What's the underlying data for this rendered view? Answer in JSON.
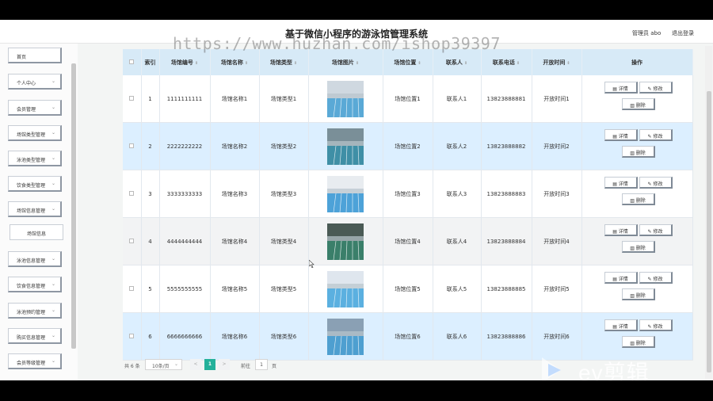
{
  "header": {
    "title": "基于微信小程序的游泳馆管理系统",
    "user": "管理员 abo",
    "logout": "退出登录",
    "watermark": "https://www.huzhan.com/ishop39397"
  },
  "sidebar": {
    "items": [
      {
        "label": "首页",
        "chevron": false
      },
      {
        "label": "个人中心",
        "chevron": true
      },
      {
        "label": "会员管理",
        "chevron": true
      },
      {
        "label": "场馆类型管理",
        "chevron": true
      },
      {
        "label": "泳池类型管理",
        "chevron": true
      },
      {
        "label": "饮食类型管理",
        "chevron": true
      },
      {
        "label": "场馆信息管理",
        "chevron": true
      },
      {
        "label": "场馆信息",
        "chevron": false,
        "sub": true
      },
      {
        "label": "泳池信息管理",
        "chevron": true
      },
      {
        "label": "饮食信息管理",
        "chevron": true
      },
      {
        "label": "泳池预约管理",
        "chevron": true
      },
      {
        "label": "购买信息管理",
        "chevron": true
      },
      {
        "label": "会员等级管理",
        "chevron": true
      }
    ]
  },
  "table": {
    "columns": [
      "索引",
      "场馆编号",
      "场馆名称",
      "场馆类型",
      "场馆图片",
      "场馆位置",
      "联系人",
      "联系电话",
      "开放时间",
      "操作"
    ],
    "actions": {
      "detail": "详情",
      "edit": "修改",
      "delete": "删除"
    },
    "rows": [
      {
        "index": "1",
        "code": "1111111111",
        "name": "场馆名称1",
        "type": "场馆类型1",
        "location": "场馆位置1",
        "contact": "联系人1",
        "phone": "13823888881",
        "hours": "开放时间1"
      },
      {
        "index": "2",
        "code": "2222222222",
        "name": "场馆名称2",
        "type": "场馆类型2",
        "location": "场馆位置2",
        "contact": "联系人2",
        "phone": "13823888882",
        "hours": "开放时间2"
      },
      {
        "index": "3",
        "code": "3333333333",
        "name": "场馆名称3",
        "type": "场馆类型3",
        "location": "场馆位置3",
        "contact": "联系人3",
        "phone": "13823888883",
        "hours": "开放时间3"
      },
      {
        "index": "4",
        "code": "4444444444",
        "name": "场馆名称4",
        "type": "场馆类型4",
        "location": "场馆位置4",
        "contact": "联系人4",
        "phone": "13823888884",
        "hours": "开放时间4"
      },
      {
        "index": "5",
        "code": "5555555555",
        "name": "场馆名称5",
        "type": "场馆类型5",
        "location": "场馆位置5",
        "contact": "联系人5",
        "phone": "13823888885",
        "hours": "开放时间5"
      },
      {
        "index": "6",
        "code": "6666666666",
        "name": "场馆名称6",
        "type": "场馆类型6",
        "location": "场馆位置6",
        "contact": "联系人6",
        "phone": "13823888886",
        "hours": "开放时间6"
      }
    ]
  },
  "pagination": {
    "total": "共 6 条",
    "page_size": "10条/页",
    "prev": "<",
    "current": "1",
    "next": ">",
    "goto_label": "前往",
    "goto_value": "1",
    "goto_unit": "页"
  },
  "overlay": {
    "ev_text": "ev剪辑"
  },
  "colors": {
    "header_row": "#d7eaf7",
    "row_blue": "#dcefff",
    "accent": "#24b19a"
  }
}
